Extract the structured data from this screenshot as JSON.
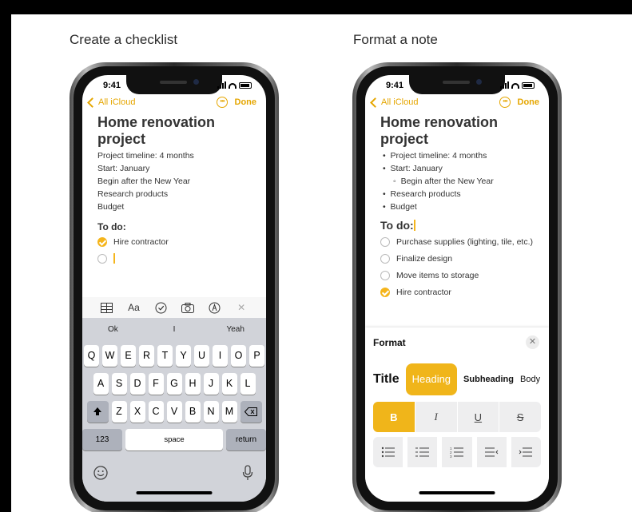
{
  "captions": {
    "left": "Create a checklist",
    "right": "Format a note"
  },
  "status_time": "9:41",
  "nav": {
    "back": "All iCloud",
    "done": "Done"
  },
  "note_title": "Home renovation project",
  "left_phone": {
    "lines": [
      "Project timeline: 4 months",
      "Start: January",
      "Begin after the New Year",
      "Research products",
      "Budget"
    ],
    "todo": "To do:",
    "checklist": [
      {
        "text": "Hire contractor",
        "checked": true
      },
      {
        "text": "",
        "checked": false
      }
    ],
    "toolbar_icons": [
      "table-icon",
      "text-format-icon",
      "checklist-icon",
      "camera-icon",
      "markup-icon",
      "close-icon"
    ],
    "toolbar_aa": "Aa",
    "toolbar_close": "✕",
    "suggestions": [
      "Ok",
      "I",
      "Yeah"
    ],
    "keys": {
      "row1": [
        "Q",
        "W",
        "E",
        "R",
        "T",
        "Y",
        "U",
        "I",
        "O",
        "P"
      ],
      "row2": [
        "A",
        "S",
        "D",
        "F",
        "G",
        "H",
        "J",
        "K",
        "L"
      ],
      "row3": [
        "Z",
        "X",
        "C",
        "V",
        "B",
        "N",
        "M"
      ],
      "numbers": "123",
      "space": "space",
      "return": "return"
    }
  },
  "right_phone": {
    "bullets": [
      "Project timeline: 4 months",
      "Start: January",
      "Research products",
      "Budget"
    ],
    "sub_bullet": "Begin after the New Year",
    "todo": "To do:",
    "checklist": [
      {
        "text": "Purchase supplies (lighting, tile, etc.)",
        "checked": false
      },
      {
        "text": "Finalize design",
        "checked": false
      },
      {
        "text": "Move items to storage",
        "checked": false
      },
      {
        "text": "Hire contractor",
        "checked": true
      }
    ],
    "format": {
      "title": "Format",
      "close": "✕",
      "styles": [
        "Title",
        "Heading",
        "Subheading",
        "Body"
      ],
      "selected_style": "Heading",
      "text_styles": [
        "B",
        "I",
        "U",
        "S"
      ],
      "selected_text_style": "B"
    }
  },
  "colors": {
    "accent": "#f0b51a",
    "link": "#e5a600"
  }
}
